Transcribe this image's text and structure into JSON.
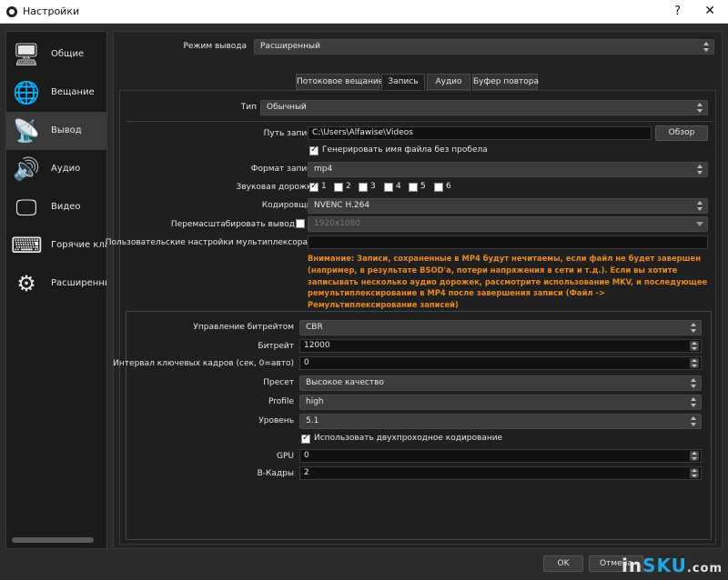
{
  "window": {
    "title": "Настройки",
    "help": "?",
    "close": "✕"
  },
  "sidebar": {
    "items": [
      {
        "label": "Общие",
        "icon": "🖥"
      },
      {
        "label": "Вещание",
        "icon": "🌐"
      },
      {
        "label": "Вывод",
        "icon": "📡"
      },
      {
        "label": "Аудио",
        "icon": "🔊"
      },
      {
        "label": "Видео",
        "icon": "🖵"
      },
      {
        "label": "Горячие клави",
        "icon": "⌨"
      },
      {
        "label": "Расширенные",
        "icon": "⚙"
      }
    ]
  },
  "output_mode": {
    "label": "Режим вывода",
    "value": "Расширенный"
  },
  "tabs": [
    "Потоковое вещание",
    "Запись",
    "Аудио",
    "Буфер повтора"
  ],
  "recording": {
    "type_label": "Тип",
    "type_value": "Обычный",
    "path_label": "Путь записи",
    "path_value": "C:\\Users\\Alfawise\\Videos",
    "browse_label": "Обзор",
    "no_space_label": "Генерировать имя файла без пробела",
    "format_label": "Формат записи",
    "format_value": "mp4",
    "tracks_label": "Звуковая дорожка",
    "tracks": [
      "1",
      "2",
      "3",
      "4",
      "5",
      "6"
    ],
    "encoder_label": "Кодировщик",
    "encoder_value": "NVENC H.264",
    "rescale_label": "Перемасштабировать вывод",
    "rescale_value": "1920x1080",
    "muxer_label": "Пользовательские настройки мультиплексора",
    "muxer_value": "",
    "warning": "Внимание: Записи, сохраненные в MP4 будут нечитаемы, если файл не будет завершен (например, в результате BSOD'а, потери напряжения в сети и т.д.). Если вы хотите записывать несколько аудио дорожек, рассмотрите использование MKV, и последующее ремультиплексирование в MP4 после завершения записи (Файл -> Ремультиплексирование записей)"
  },
  "encoder_settings": {
    "rate_control_label": "Управление битрейтом",
    "rate_control_value": "CBR",
    "bitrate_label": "Битрейт",
    "bitrate_value": "12000",
    "keyframe_label": "Интервал ключевых кадров (сек, 0=авто)",
    "keyframe_value": "0",
    "preset_label": "Пресет",
    "preset_value": "Высокое качество",
    "profile_label": "Profile",
    "profile_value": "high",
    "level_label": "Уровень",
    "level_value": "5.1",
    "twopass_label": "Использовать двухпроходное кодирование",
    "gpu_label": "GPU",
    "gpu_value": "0",
    "bframes_label": "B-Кадры",
    "bframes_value": "2"
  },
  "footer": {
    "ok": "OK",
    "cancel": "Отмена"
  },
  "watermark": {
    "main": "in",
    "accent": "SKU",
    "suffix": ".com"
  }
}
